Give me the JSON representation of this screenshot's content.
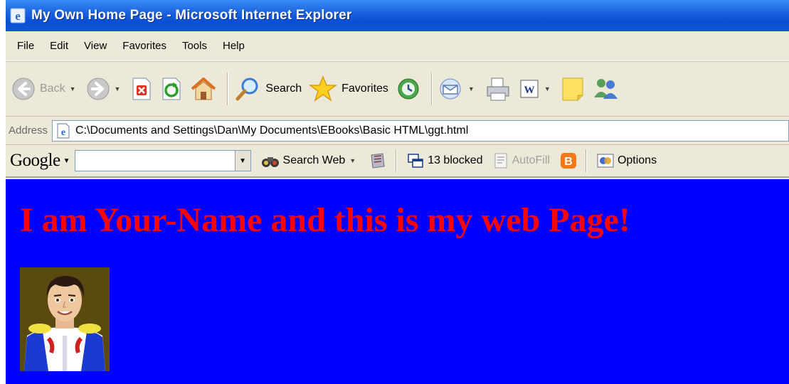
{
  "window": {
    "title": "My Own Home Page - Microsoft Internet Explorer"
  },
  "menu": [
    "File",
    "Edit",
    "View",
    "Favorites",
    "Tools",
    "Help"
  ],
  "toolbar": {
    "back_label": "Back",
    "search_label": "Search",
    "favorites_label": "Favorites"
  },
  "address": {
    "label": "Address",
    "value": "C:\\Documents and Settings\\Dan\\My Documents\\EBooks\\Basic HTML\\ggt.html"
  },
  "google_bar": {
    "logo": "Google",
    "search_web_label": "Search Web",
    "blocked_label": "13 blocked",
    "autofill_label": "AutoFill",
    "options_label": "Options"
  },
  "page": {
    "heading": "I am Your-Name and this is my web Page!",
    "background_color": "#0000ff",
    "heading_color": "#ff0000"
  },
  "icons": [
    "ie-logo-icon",
    "back-icon",
    "forward-icon",
    "stop-icon",
    "refresh-icon",
    "home-icon",
    "search-icon",
    "favorites-star-icon",
    "history-icon",
    "mail-icon",
    "print-icon",
    "word-icon",
    "notes-icon",
    "messenger-icon",
    "page-icon",
    "binoculars-icon",
    "popup-blocker-icon",
    "autofill-icon",
    "blogger-icon",
    "options-icon"
  ]
}
